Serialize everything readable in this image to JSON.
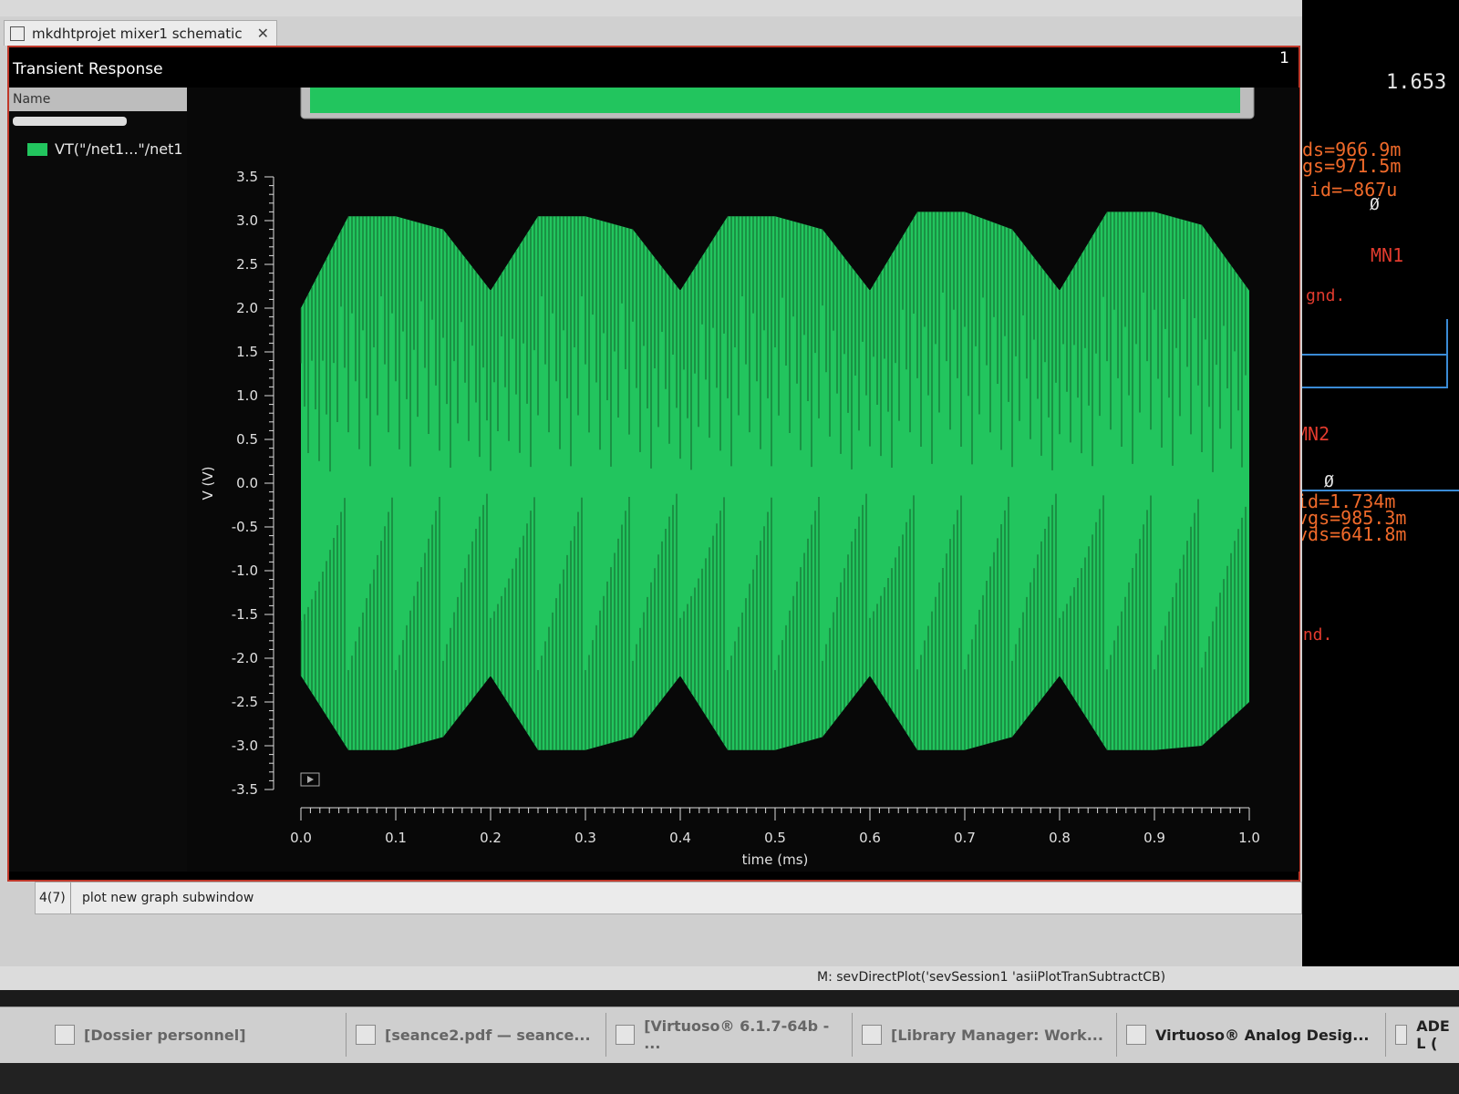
{
  "tab": {
    "title": "mkdhtprojet mixer1 schematic",
    "close": "✕"
  },
  "plot": {
    "window_title": "Transient Response",
    "subwindow_number": "1",
    "legend_header": "Name",
    "legend_entries": [
      {
        "label": "VT(\"/net1...\"/net1",
        "color": "#22c55e"
      }
    ]
  },
  "chart_data": {
    "type": "line",
    "xlabel": "time (ms)",
    "ylabel": "V (V)",
    "xlim": [
      0.0,
      1.0
    ],
    "ylim": [
      -3.5,
      3.5
    ],
    "x_ticks": [
      "0.0",
      "0.1",
      "0.2",
      "0.3",
      "0.4",
      "0.5",
      "0.6",
      "0.7",
      "0.8",
      "0.9",
      "1.0"
    ],
    "y_ticks": [
      "3.5",
      "3.0",
      "2.5",
      "2.0",
      "1.5",
      "1.0",
      "0.5",
      "0.0",
      "-0.5",
      "-1.0",
      "-1.5",
      "-2.0",
      "-2.5",
      "-3.0",
      "-3.5"
    ],
    "series": [
      {
        "name": "VT(\"/net1...\"/net1",
        "color": "#22c55e",
        "envelope_x": [
          0.0,
          0.05,
          0.1,
          0.15,
          0.2,
          0.25,
          0.3,
          0.35,
          0.4,
          0.45,
          0.5,
          0.55,
          0.6,
          0.65,
          0.7,
          0.75,
          0.8,
          0.85,
          0.9,
          0.95,
          1.0
        ],
        "envelope_upper": [
          2.0,
          3.05,
          3.05,
          2.9,
          2.2,
          3.05,
          3.05,
          2.9,
          2.2,
          3.05,
          3.05,
          2.9,
          2.2,
          3.1,
          3.1,
          2.9,
          2.2,
          3.1,
          3.1,
          2.95,
          2.2
        ],
        "envelope_lower": [
          -2.2,
          -3.05,
          -3.05,
          -2.9,
          -2.2,
          -3.05,
          -3.05,
          -2.9,
          -2.2,
          -3.05,
          -3.05,
          -2.9,
          -2.2,
          -3.05,
          -3.05,
          -2.9,
          -2.2,
          -3.05,
          -3.05,
          -3.0,
          -2.5
        ]
      }
    ]
  },
  "status": {
    "index": "4(7)",
    "message": "plot new graph subwindow"
  },
  "mouse_line": "M: sevDirectPlot('sevSession1 'asiiPlotTranSubtractCB)",
  "taskbar": [
    {
      "label": "[Dossier personnel]",
      "active": false
    },
    {
      "label": "[seance2.pdf — seance...",
      "active": false
    },
    {
      "label": "[Virtuoso® 6.1.7-64b - ...",
      "active": false
    },
    {
      "label": "[Library Manager: Work...",
      "active": false
    },
    {
      "label": "Virtuoso® Analog Desig...",
      "active": true
    },
    {
      "label": "ADE L (",
      "active": true
    }
  ],
  "schematic": {
    "value_top": "1.653",
    "ids": "ds=966.9m",
    "vgs": "gs=971.5m",
    "id1": "id=−867u",
    "zero1": "Ø",
    "mn1": "MN1",
    "gnd1": "gnd.",
    "mn2": "MN2",
    "zero2": "Ø",
    "id2": "id=1.734m",
    "vgs2": "vgs=985.3m",
    "vds2": "vds=641.8m",
    "gnd2": "gnd."
  }
}
